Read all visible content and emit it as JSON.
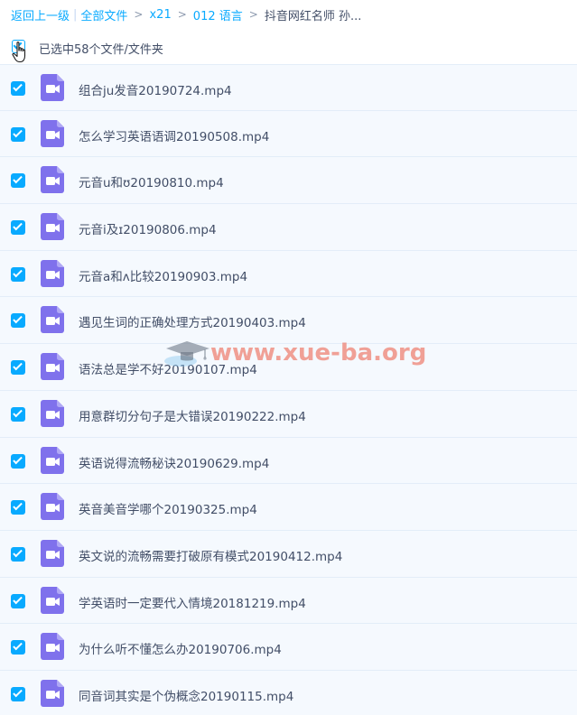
{
  "breadcrumb": {
    "back_label": "返回上一级",
    "pipe": "|",
    "items": [
      "全部文件",
      "x21",
      "012 语言"
    ],
    "separator": ">",
    "current": "抖音网红名师 孙..."
  },
  "selection": {
    "count_label": "已选中58个文件/文件夹",
    "all_checked": true
  },
  "files": [
    {
      "name": "组合ju发音20190724.mp4",
      "checked": true,
      "icon": "video-file-icon"
    },
    {
      "name": "怎么学习英语语调20190508.mp4",
      "checked": true,
      "icon": "video-file-icon"
    },
    {
      "name": "元音u和ʊ20190810.mp4",
      "checked": true,
      "icon": "video-file-icon"
    },
    {
      "name": "元音i及ɪ20190806.mp4",
      "checked": true,
      "icon": "video-file-icon"
    },
    {
      "name": "元音a和ʌ比较20190903.mp4",
      "checked": true,
      "icon": "video-file-icon"
    },
    {
      "name": "遇见生词的正确处理方式20190403.mp4",
      "checked": true,
      "icon": "video-file-icon"
    },
    {
      "name": "语法总是学不好20190107.mp4",
      "checked": true,
      "icon": "video-file-icon"
    },
    {
      "name": "用意群切分句子是大错误20190222.mp4",
      "checked": true,
      "icon": "video-file-icon"
    },
    {
      "name": "英语说得流畅秘诀20190629.mp4",
      "checked": true,
      "icon": "video-file-icon"
    },
    {
      "name": "英音美音学哪个20190325.mp4",
      "checked": true,
      "icon": "video-file-icon"
    },
    {
      "name": "英文说的流畅需要打破原有模式20190412.mp4",
      "checked": true,
      "icon": "video-file-icon"
    },
    {
      "name": "学英语时一定要代入情境20181219.mp4",
      "checked": true,
      "icon": "video-file-icon"
    },
    {
      "name": "为什么听不懂怎么办20190706.mp4",
      "checked": true,
      "icon": "video-file-icon"
    },
    {
      "name": "同音词其实是个伪概念20190115.mp4",
      "checked": true,
      "icon": "video-file-icon"
    }
  ],
  "watermark": {
    "text": "www.xue-ba.org"
  },
  "colors": {
    "accent": "#09aaff",
    "video_icon": "#7f71ec",
    "row_background": "#f5f9fe",
    "text": "#424e67",
    "watermark": "#ee7d6e"
  }
}
